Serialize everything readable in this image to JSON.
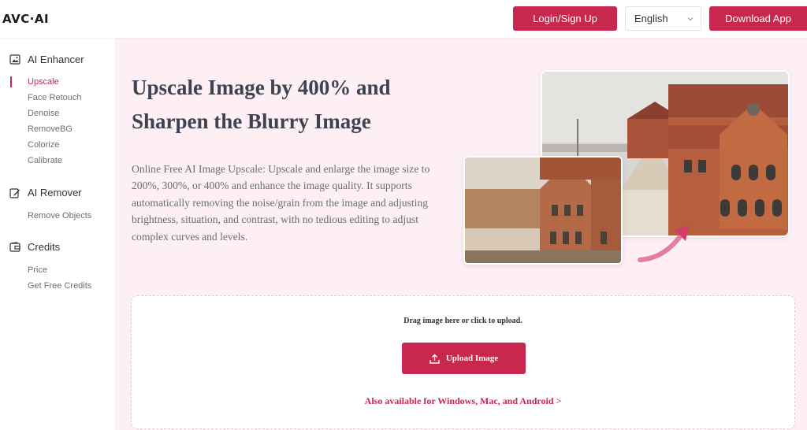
{
  "header": {
    "logo": "AVC·AI",
    "login_label": "Login/Sign Up",
    "language": "English",
    "download_label": "Download App"
  },
  "sidebar": {
    "sections": [
      {
        "label": "AI Enhancer",
        "icon": "image-icon",
        "items": [
          "Upscale",
          "Face Retouch",
          "Denoise",
          "RemoveBG",
          "Colorize",
          "Calibrate"
        ]
      },
      {
        "label": "AI Remover",
        "icon": "edit-icon",
        "items": [
          "Remove Objects"
        ]
      },
      {
        "label": "Credits",
        "icon": "wallet-icon",
        "items": [
          "Price",
          "Get Free Credits"
        ]
      }
    ],
    "active_item": "Upscale"
  },
  "main": {
    "title_line1": "Upscale Image by 400% and",
    "title_line2": "Sharpen the Blurry Image",
    "description": "Online Free AI Image Upscale: Upscale and enlarge the image size to 200%, 300%, or 400% and enhance the image quality. It supports automatically removing the noise/grain from the image and adjusting brightness, situation, and contrast, with no tedious editing to adjust complex curves and levels."
  },
  "upload": {
    "drag_text": "Drag image here or click to upload.",
    "button_label": "Upload Image",
    "platforms_link": "Also available for Windows, Mac, and Android >"
  },
  "colors": {
    "accent": "#c8284e",
    "background": "#fdeff4"
  }
}
